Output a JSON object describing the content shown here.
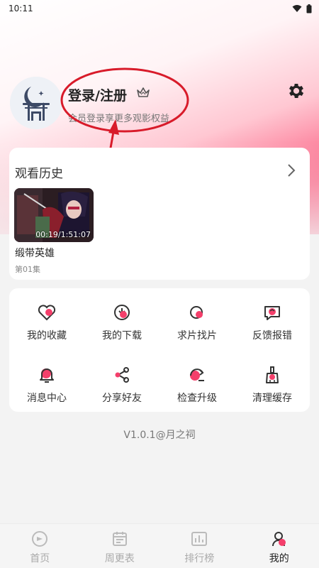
{
  "status_bar": {
    "time": "10:11"
  },
  "profile": {
    "title": "登录/注册",
    "subtitle": "会员登录享更多观影权益"
  },
  "history": {
    "title": "观看历史",
    "items": [
      {
        "title": "缎带英雄",
        "episode": "第01集",
        "progress": "00:19/1:51:07"
      }
    ]
  },
  "grid": {
    "items": [
      {
        "label": "我的收藏",
        "icon": "heart-icon"
      },
      {
        "label": "我的下载",
        "icon": "download-icon"
      },
      {
        "label": "求片找片",
        "icon": "search-film-icon"
      },
      {
        "label": "反馈报错",
        "icon": "feedback-icon"
      },
      {
        "label": "消息中心",
        "icon": "bell-icon"
      },
      {
        "label": "分享好友",
        "icon": "share-icon"
      },
      {
        "label": "检查升级",
        "icon": "upgrade-icon"
      },
      {
        "label": "清理缓存",
        "icon": "broom-icon"
      }
    ]
  },
  "version": "V1.0.1@月之祠",
  "tabbar": {
    "items": [
      {
        "label": "首页",
        "icon": "home-icon"
      },
      {
        "label": "周更表",
        "icon": "calendar-icon"
      },
      {
        "label": "排行榜",
        "icon": "chart-icon"
      },
      {
        "label": "我的",
        "icon": "profile-icon"
      }
    ],
    "active": "我的"
  },
  "colors": {
    "accent": "#f43f6b",
    "icon_dark": "#333333"
  }
}
